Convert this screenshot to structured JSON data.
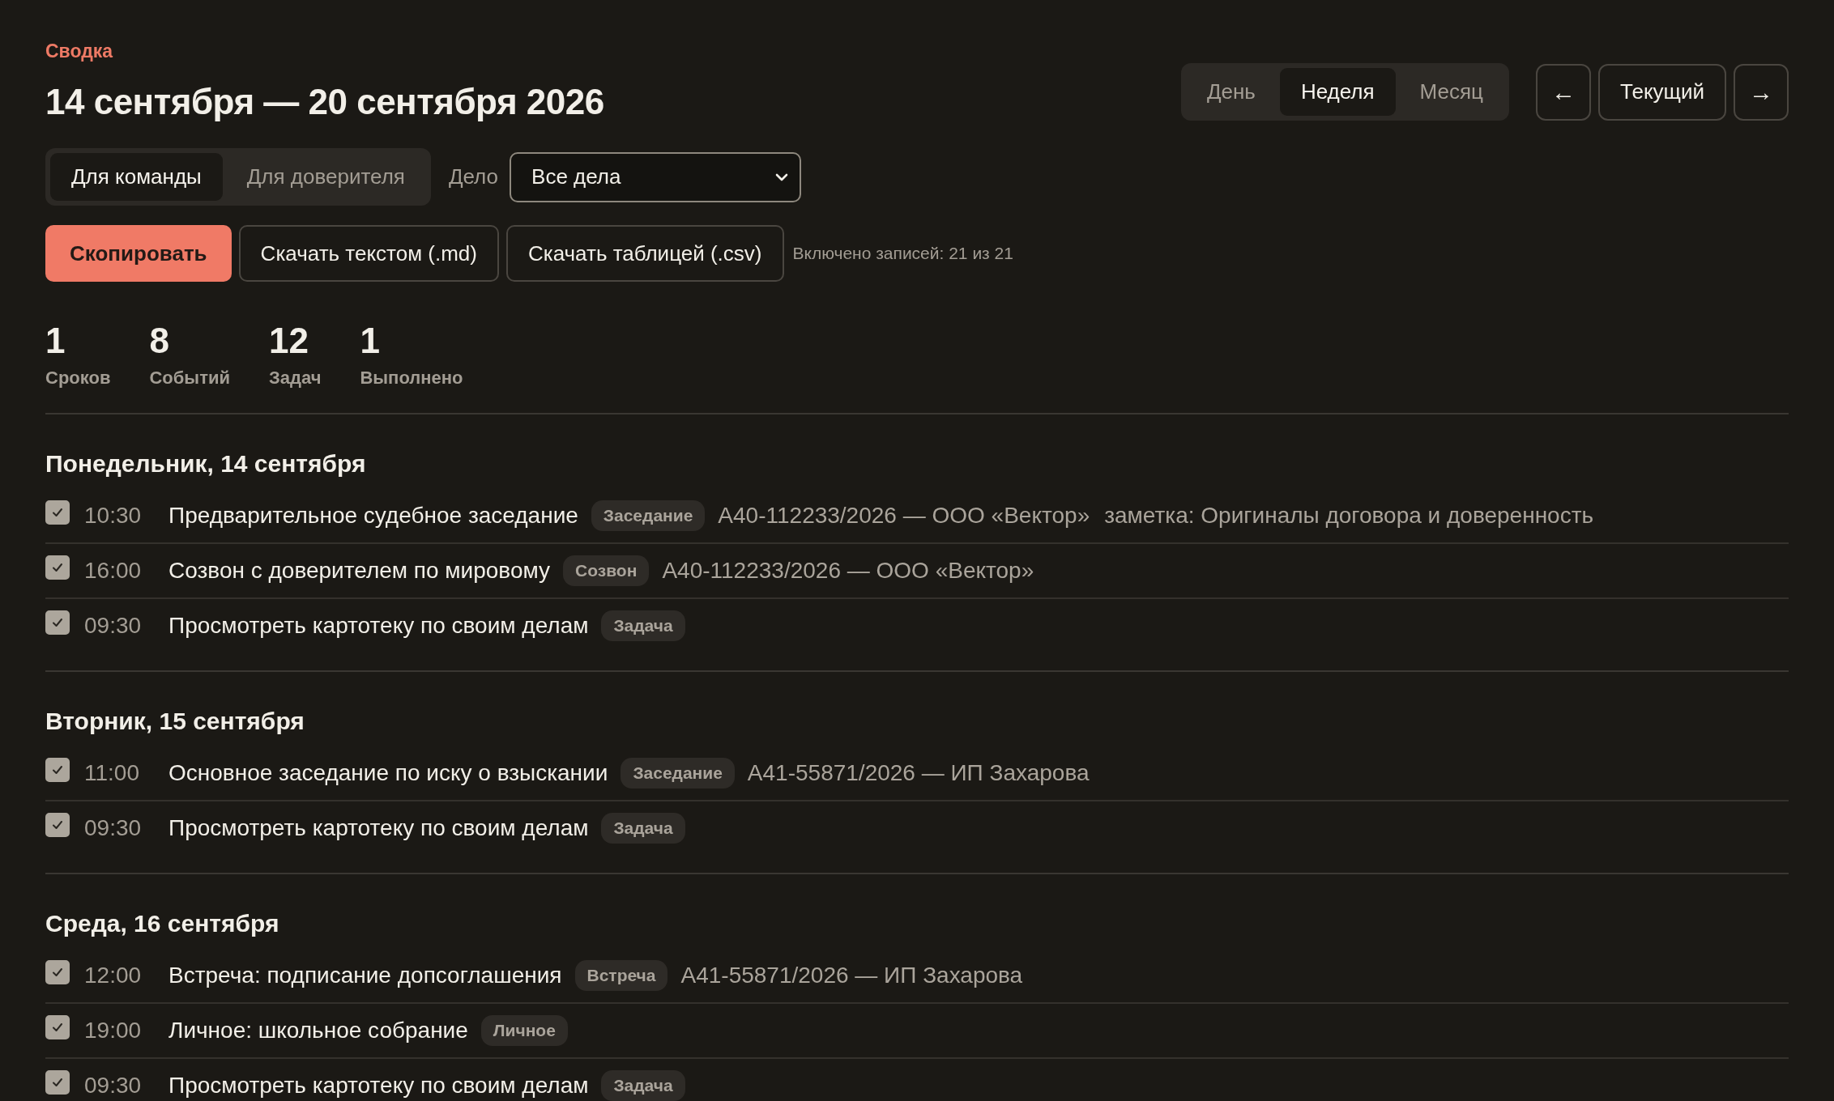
{
  "eyebrow": "Сводка",
  "title": "14 сентября — 20 сентября 2026",
  "period_tabs": [
    {
      "label": "День",
      "selected": false
    },
    {
      "label": "Неделя",
      "selected": true
    },
    {
      "label": "Месяц",
      "selected": false
    }
  ],
  "nav": {
    "prev": "←",
    "current": "Текущий",
    "next": "→"
  },
  "audience_tabs": [
    {
      "label": "Для команды",
      "selected": true
    },
    {
      "label": "Для доверителя",
      "selected": false
    }
  ],
  "case_filter": {
    "label": "Дело",
    "value": "Все дела"
  },
  "actions": [
    {
      "label": "Скопировать",
      "kind": "primary"
    },
    {
      "label": "Скачать текстом (.md)",
      "kind": "secondary"
    },
    {
      "label": "Скачать таблицей (.csv)",
      "kind": "secondary"
    }
  ],
  "included": "Включено записей: 21 из 21",
  "stats": [
    {
      "value": "1",
      "label": "Сроков"
    },
    {
      "value": "8",
      "label": "Событий"
    },
    {
      "value": "12",
      "label": "Задач"
    },
    {
      "value": "1",
      "label": "Выполнено"
    }
  ],
  "days": [
    {
      "heading": "Понедельник, 14 сентября",
      "items": [
        {
          "checked": true,
          "time": "10:30",
          "title": "Предварительное судебное заседание",
          "tag": "Заседание",
          "case": "А40-112233/2026 — ООО «Вектор»",
          "note": "заметка: Оригиналы договора и доверенность"
        },
        {
          "checked": true,
          "time": "16:00",
          "title": "Созвон с доверителем по мировому",
          "tag": "Созвон",
          "case": "А40-112233/2026 — ООО «Вектор»"
        },
        {
          "checked": true,
          "time": "09:30",
          "title": "Просмотреть картотеку по своим делам",
          "tag": "Задача"
        }
      ]
    },
    {
      "heading": "Вторник, 15 сентября",
      "items": [
        {
          "checked": true,
          "time": "11:00",
          "title": "Основное заседание по иску о взыскании",
          "tag": "Заседание",
          "case": "А41-55871/2026 — ИП Захарова"
        },
        {
          "checked": true,
          "time": "09:30",
          "title": "Просмотреть картотеку по своим делам",
          "tag": "Задача"
        }
      ]
    },
    {
      "heading": "Среда, 16 сентября",
      "items": [
        {
          "checked": true,
          "time": "12:00",
          "title": "Встреча: подписание допсоглашения",
          "tag": "Встреча",
          "case": "А41-55871/2026 — ИП Захарова"
        },
        {
          "checked": true,
          "time": "19:00",
          "title": "Личное: школьное собрание",
          "tag": "Личное"
        },
        {
          "checked": true,
          "time": "09:30",
          "title": "Просмотреть картотеку по своим делам",
          "tag": "Задача"
        }
      ]
    }
  ]
}
